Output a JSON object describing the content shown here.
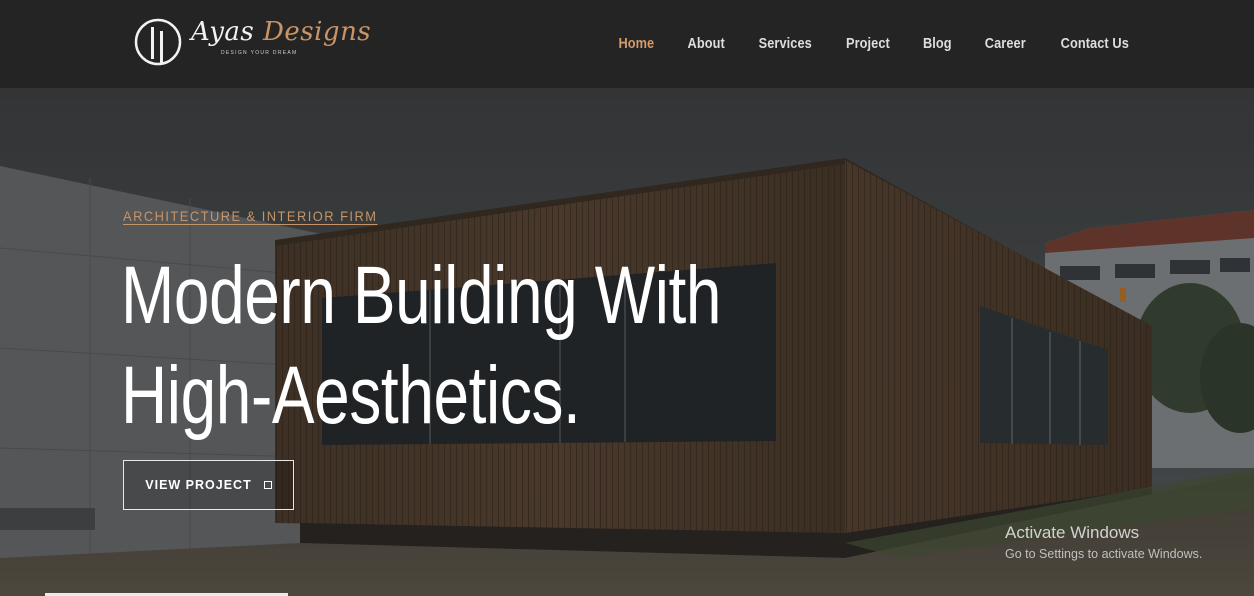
{
  "header": {
    "logo": {
      "name_part1": "Ayas",
      "name_part2": "Designs",
      "tagline": "DESIGN YOUR DREAM"
    },
    "nav": [
      {
        "label": "Home",
        "active": true
      },
      {
        "label": "About",
        "active": false
      },
      {
        "label": "Services",
        "active": false
      },
      {
        "label": "Project",
        "active": false
      },
      {
        "label": "Blog",
        "active": false
      },
      {
        "label": "Career",
        "active": false
      },
      {
        "label": "Contact Us",
        "active": false
      }
    ]
  },
  "hero": {
    "eyebrow": "ARCHITECTURE & INTERIOR FIRM",
    "headline_line1": "Modern Building With",
    "headline_line2": "High-Aesthetics.",
    "cta_label": "VIEW PROJECT",
    "cta_icon": "square-icon"
  },
  "watermark": {
    "title": "Activate Windows",
    "subtitle": "Go to Settings to activate Windows."
  },
  "colors": {
    "header_bg": "#252424",
    "accent": "#d39a6a",
    "nav_text": "#dedede",
    "headline": "#ffffff"
  }
}
